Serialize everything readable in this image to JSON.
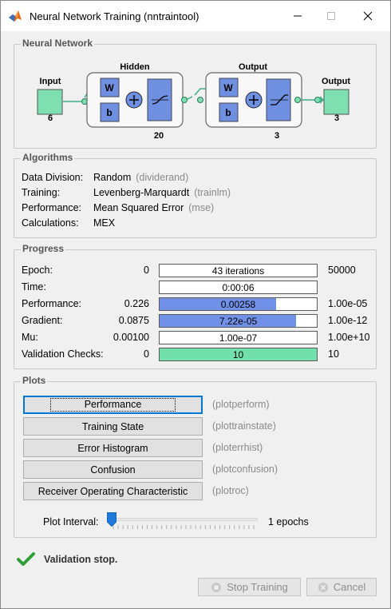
{
  "window": {
    "title": "Neural Network Training (nntraintool)",
    "icon": "matlab-icon",
    "controls": [
      "minimize-icon",
      "maximize-icon",
      "close-icon"
    ]
  },
  "network": {
    "section_title": "Neural Network",
    "input": {
      "label": "Input",
      "size": "6"
    },
    "hidden": {
      "label": "Hidden",
      "size": "20",
      "weight": "W",
      "bias": "b"
    },
    "output_layer": {
      "label": "Output",
      "size": "3",
      "weight": "W",
      "bias": "b"
    },
    "output": {
      "label": "Output",
      "size": "3"
    },
    "colors": {
      "node": "#7ee0b0",
      "weight_box": "#6f8fe0",
      "transfer_box": "#6f8fe0",
      "layer_bg": "#f8f8f8"
    }
  },
  "algorithms": {
    "section_title": "Algorithms",
    "rows": [
      {
        "label": "Data Division:",
        "value": "Random",
        "fn": "(dividerand)"
      },
      {
        "label": "Training:",
        "value": "Levenberg-Marquardt",
        "fn": "(trainlm)"
      },
      {
        "label": "Performance:",
        "value": "Mean Squared Error",
        "fn": "(mse)"
      },
      {
        "label": "Calculations:",
        "value": "MEX",
        "fn": ""
      }
    ]
  },
  "progress": {
    "section_title": "Progress",
    "rows": [
      {
        "label": "Epoch:",
        "start": "0",
        "current": "43 iterations",
        "end": "50000",
        "fill": 0,
        "color": "#ffffff"
      },
      {
        "label": "Time:",
        "start": "",
        "current": "0:00:06",
        "end": "",
        "fill": 0,
        "color": "#ffffff"
      },
      {
        "label": "Performance:",
        "start": "0.226",
        "current": "0.00258",
        "end": "1.00e-05",
        "fill": 0.74,
        "color": "#7190e8"
      },
      {
        "label": "Gradient:",
        "start": "0.0875",
        "current": "7.22e-05",
        "end": "1.00e-12",
        "fill": 0.87,
        "color": "#7190e8"
      },
      {
        "label": "Mu:",
        "start": "0.00100",
        "current": "1.00e-07",
        "end": "1.00e+10",
        "fill": 0,
        "color": "#7190e8"
      },
      {
        "label": "Validation Checks:",
        "start": "0",
        "current": "10",
        "end": "10",
        "fill": 1.0,
        "color": "#72e0ac"
      }
    ]
  },
  "plots": {
    "section_title": "Plots",
    "buttons": [
      {
        "label": "Performance",
        "fn": "(plotperform)"
      },
      {
        "label": "Training State",
        "fn": "(plottrainstate)"
      },
      {
        "label": "Error Histogram",
        "fn": "(ploterrhist)"
      },
      {
        "label": "Confusion",
        "fn": "(plotconfusion)"
      },
      {
        "label": "Receiver Operating Characteristic",
        "fn": "(plotroc)"
      }
    ],
    "interval_label": "Plot Interval:",
    "interval_value": "1 epochs",
    "interval_level": 0.0
  },
  "status": {
    "icon": "checkmark-icon",
    "text": "Validation stop."
  },
  "footer": {
    "stop_label": "Stop Training",
    "cancel_label": "Cancel"
  }
}
